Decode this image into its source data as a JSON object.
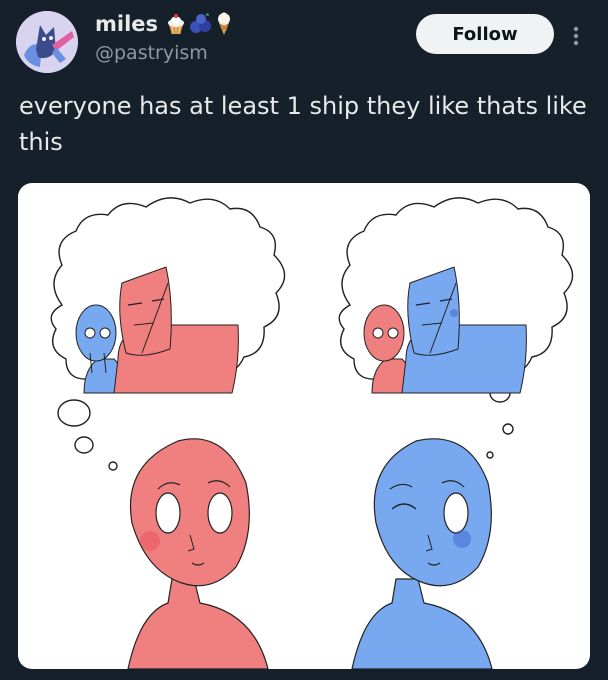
{
  "user": {
    "display_name": "miles",
    "handle": "@pastryism",
    "name_emojis": [
      "cupcake-icon",
      "blueberries-icon",
      "ice-cream-icon"
    ],
    "avatar_icon": "cat-avatar-icon"
  },
  "actions": {
    "follow_label": "Follow",
    "more_icon": "more-vertical-icon"
  },
  "tweet": {
    "text": "everyone has at least 1 ship they like thats like this"
  },
  "media": {
    "type": "drawing",
    "panels": [
      "pink-character-dreaming-of-blue-and-pink",
      "blue-character-dreaming-of-pink-and-blue"
    ]
  },
  "colors": {
    "background": "#15202b",
    "text": "#e7e9ea",
    "secondary_text": "#8b98a5",
    "follow_bg": "#eff3f4",
    "pink": "#f08080",
    "blue": "#78a8f0"
  }
}
